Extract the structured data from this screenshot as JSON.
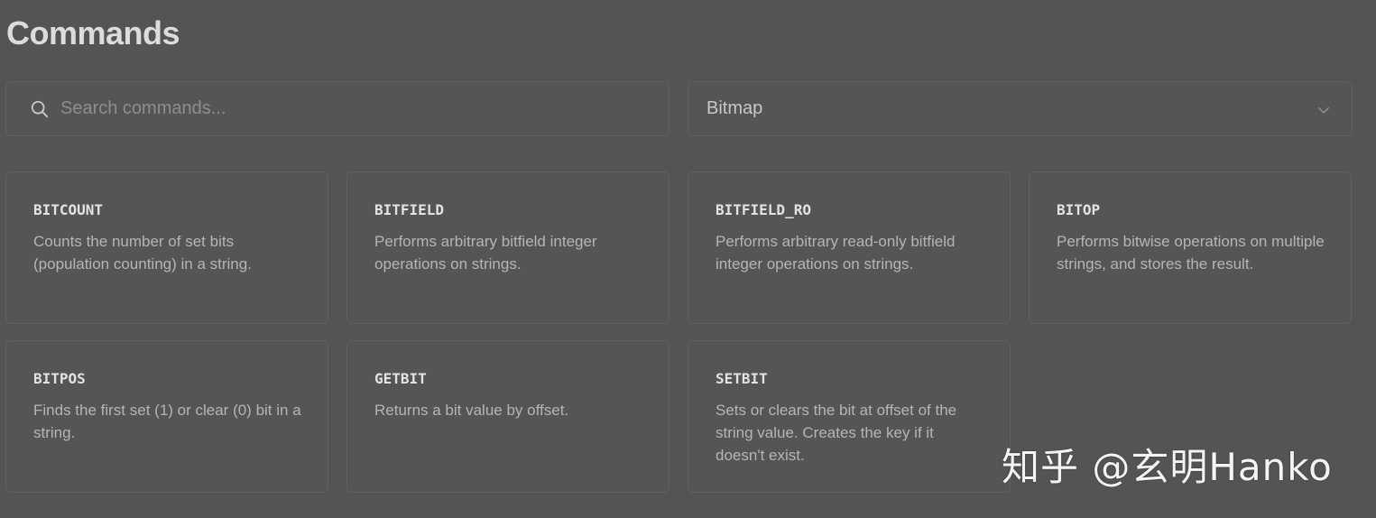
{
  "header": {
    "title": "Commands"
  },
  "search": {
    "placeholder": "Search commands...",
    "value": ""
  },
  "filter": {
    "selected": "Bitmap"
  },
  "icons": {
    "search": "search-icon",
    "chevron": "chevron-down-icon"
  },
  "commands": [
    {
      "name": "BITCOUNT",
      "description": "Counts the number of set bits (population counting) in a string."
    },
    {
      "name": "BITFIELD",
      "description": "Performs arbitrary bitfield integer operations on strings."
    },
    {
      "name": "BITFIELD_RO",
      "description": "Performs arbitrary read-only bitfield integer operations on strings."
    },
    {
      "name": "BITOP",
      "description": "Performs bitwise operations on multiple strings, and stores the result."
    },
    {
      "name": "BITPOS",
      "description": "Finds the first set (1) or clear (0) bit in a string."
    },
    {
      "name": "GETBIT",
      "description": "Returns a bit value by offset."
    },
    {
      "name": "SETBIT",
      "description": "Sets or clears the bit at offset of the string value. Creates the key if it doesn't exist."
    }
  ],
  "watermark": {
    "text": "知乎 @玄明Hanko"
  },
  "colors": {
    "background": "#535456",
    "border": "#5f6062",
    "title": "#dcdcdc",
    "muted": "#b4b5b7"
  }
}
